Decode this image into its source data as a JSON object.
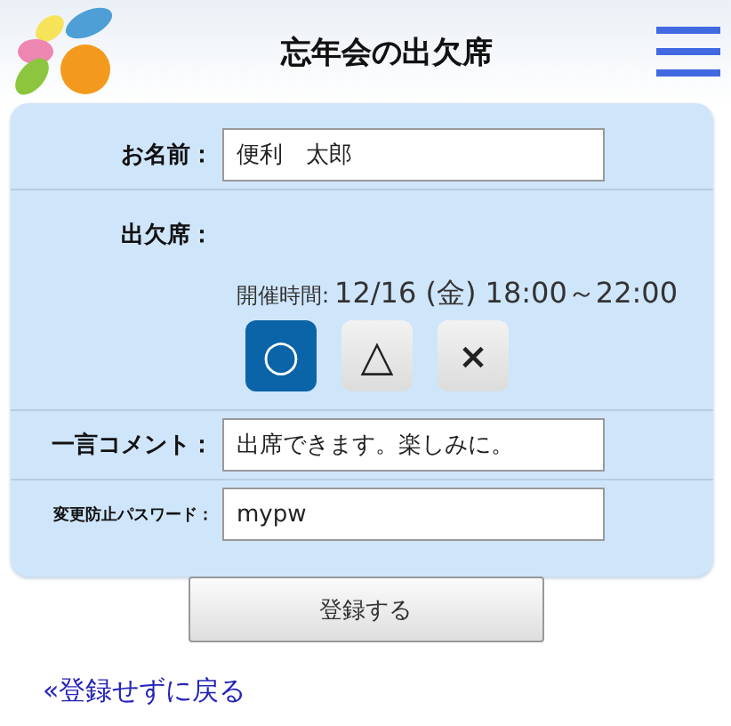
{
  "header": {
    "title": "忘年会の出欠席"
  },
  "form": {
    "name": {
      "label": "お名前：",
      "value": "便利　太郎"
    },
    "attendance": {
      "label": "出欠席：",
      "time_label": "開催時間:",
      "time": "12/16 (金) 18:00～22:00",
      "options": [
        {
          "symbol": "○",
          "selected": true
        },
        {
          "symbol": "△",
          "selected": false
        },
        {
          "symbol": "×",
          "selected": false
        }
      ]
    },
    "comment": {
      "label": "一言コメント：",
      "value": "出席できます。楽しみに。"
    },
    "password": {
      "label": "変更防止パスワード：",
      "value": "mypw"
    }
  },
  "submit_button": "登録する",
  "back_link": "«登録せずに戻る"
}
